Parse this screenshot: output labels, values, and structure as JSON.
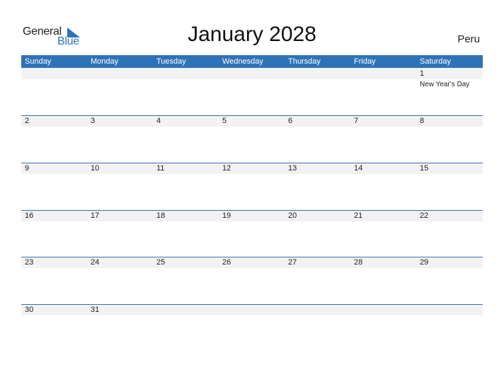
{
  "logo": {
    "word1": "General",
    "word2": "Blue"
  },
  "title": "January 2028",
  "country": "Peru",
  "colors": {
    "accent": "#2e73b8",
    "band": "#f2f2f2"
  },
  "weekdays": [
    "Sunday",
    "Monday",
    "Tuesday",
    "Wednesday",
    "Thursday",
    "Friday",
    "Saturday"
  ],
  "weeks": [
    [
      "",
      "",
      "",
      "",
      "",
      "",
      "1"
    ],
    [
      "2",
      "3",
      "4",
      "5",
      "6",
      "7",
      "8"
    ],
    [
      "9",
      "10",
      "11",
      "12",
      "13",
      "14",
      "15"
    ],
    [
      "16",
      "17",
      "18",
      "19",
      "20",
      "21",
      "22"
    ],
    [
      "23",
      "24",
      "25",
      "26",
      "27",
      "28",
      "29"
    ],
    [
      "30",
      "31",
      "",
      "",
      "",
      "",
      ""
    ]
  ],
  "events": [
    {
      "week": 0,
      "day": 6,
      "label": "New Year's Day"
    }
  ]
}
